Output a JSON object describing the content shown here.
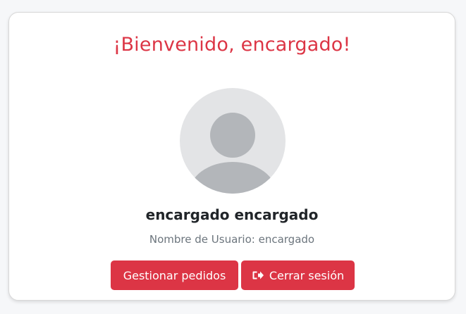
{
  "welcome": {
    "title": "¡Bienvenido, encargado!"
  },
  "profile": {
    "display_name": "encargado encargado",
    "username_line": "Nombre de Usuario: encargado",
    "avatar_icon": "user-avatar-placeholder-icon"
  },
  "actions": {
    "manage_orders_label": "Gestionar pedidos",
    "logout_label": "Cerrar sesión",
    "logout_icon": "sign-out-icon"
  },
  "colors": {
    "accent": "#dc3545",
    "text": "#212529",
    "muted": "#6c757d",
    "avatar_bg": "#e3e4e6",
    "avatar_figure": "#b3b6ba"
  }
}
